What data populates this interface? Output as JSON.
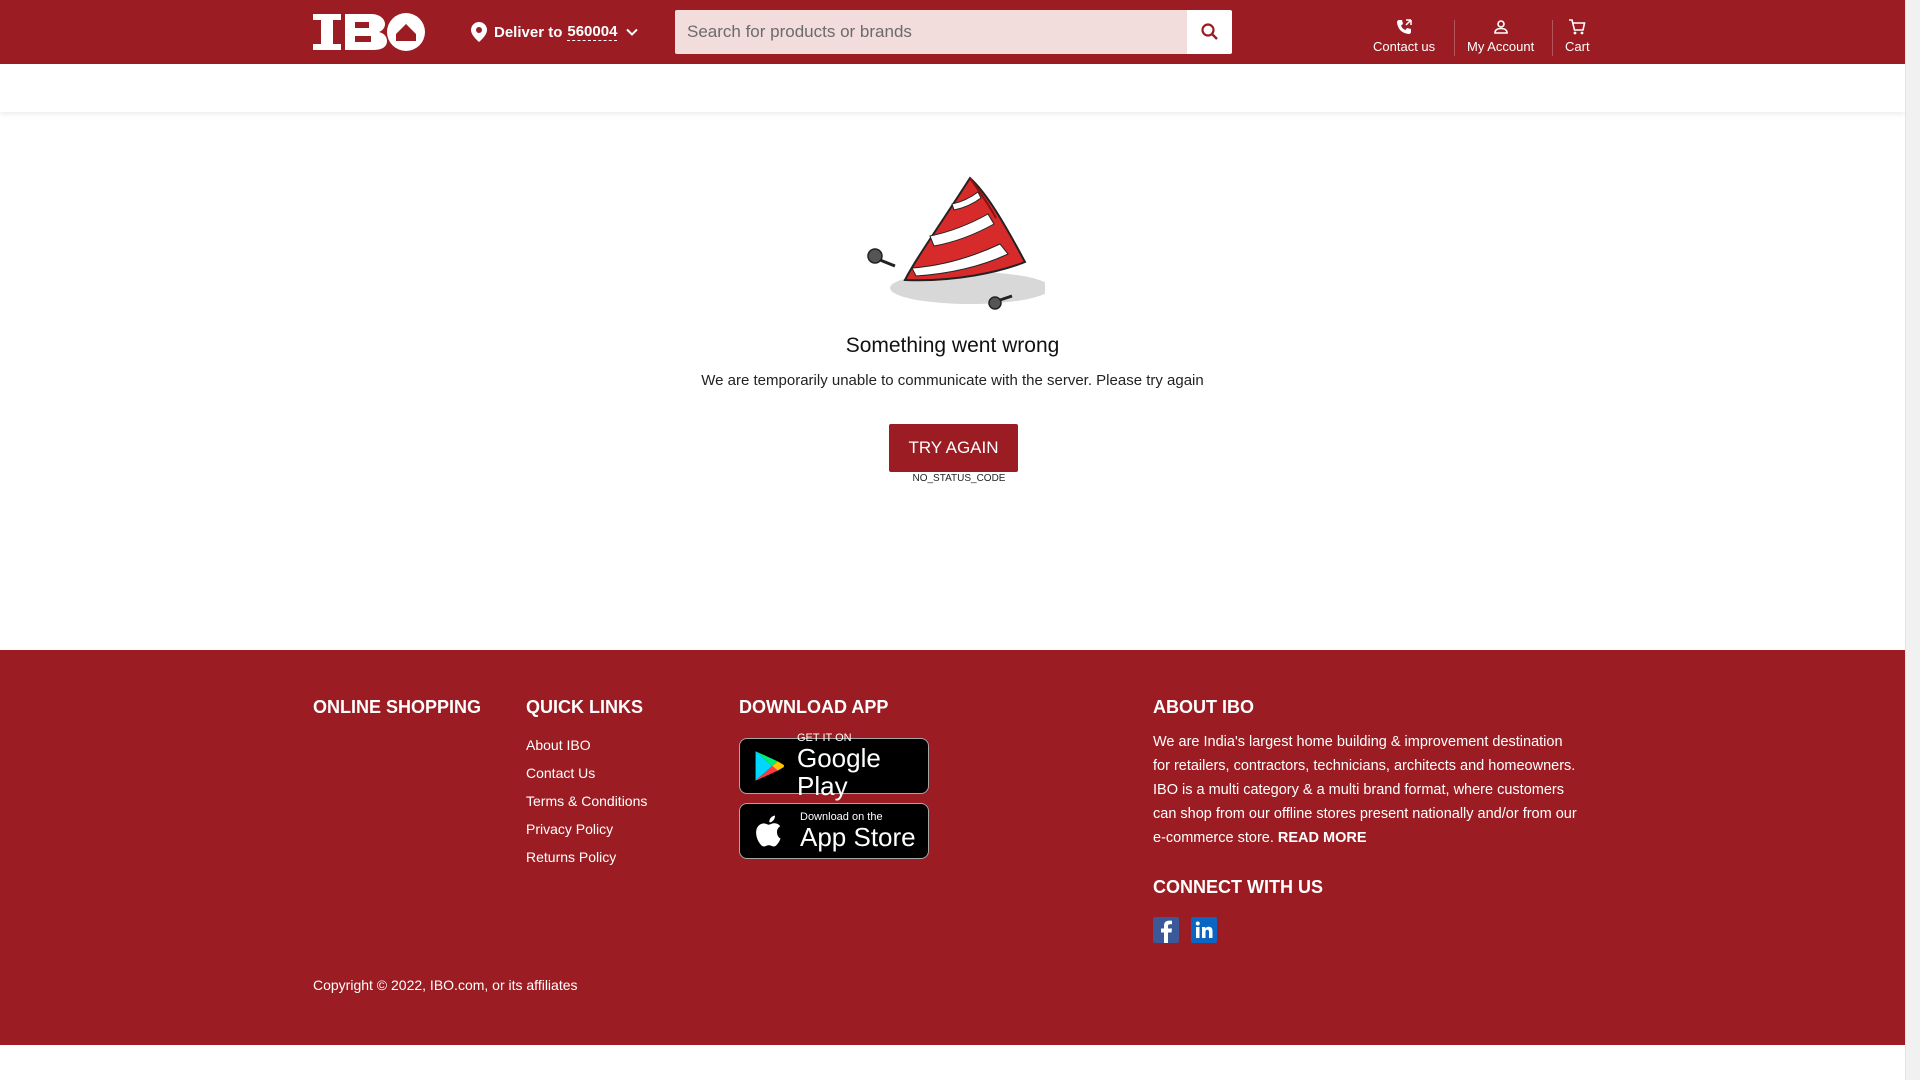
{
  "header": {
    "logo_text": "IBO",
    "deliver_label": "Deliver to",
    "pincode": "560004",
    "search_placeholder": "Search for products or brands",
    "nav": {
      "contact_label": "Contact us",
      "account_label": "My Account",
      "cart_label": "Cart"
    }
  },
  "error": {
    "title": "Something went wrong",
    "message": "We are temporarily unable to communicate with the server. Please try again",
    "button_label": "TRY AGAIN",
    "status_code": "NO_STATUS_CODE"
  },
  "footer": {
    "online_shopping": {
      "heading": "ONLINE SHOPPING"
    },
    "quick_links": {
      "heading": "QUICK LINKS",
      "items": [
        "About IBO",
        "Contact Us",
        "Terms & Conditions",
        "Privacy Policy",
        "Returns Policy"
      ]
    },
    "download_app": {
      "heading": "DOWNLOAD APP",
      "google_play": {
        "small": "GET IT ON",
        "big": "Google Play"
      },
      "app_store": {
        "small": "Download on the",
        "big": "App Store"
      }
    },
    "about": {
      "heading": "ABOUT IBO",
      "text": "We are India's largest home building & improvement destination for retailers, contractors, technicians, architects and homeowners. IBO is a multi category & a multi brand format, where customers can shop from our offline stores present nationally and/or from our e-commerce store.",
      "read_more": "READ MORE"
    },
    "connect": {
      "heading": "CONNECT WITH US",
      "facebook_icon": "facebook-icon",
      "linkedin_icon": "linkedin-icon"
    },
    "copyright": "Copyright © 2022, IBO.com, or its affiliates"
  },
  "colors": {
    "brand": "#9b1c22",
    "search_bg": "#f2dcdc",
    "facebook": "#3b5998",
    "linkedin": "#0a66c2"
  }
}
